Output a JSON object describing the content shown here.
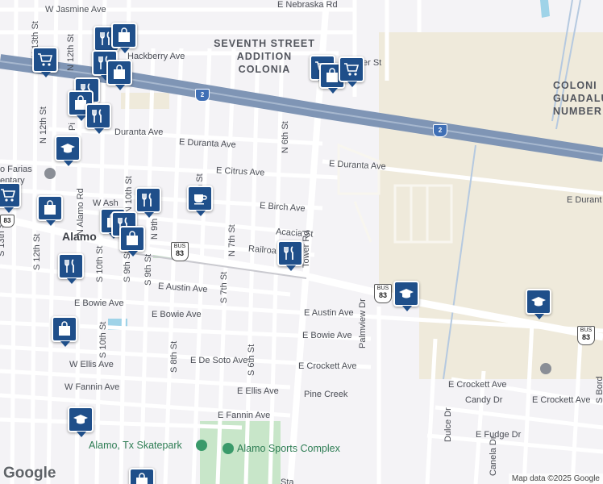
{
  "map": {
    "city": "Alamo",
    "neighborhoods": {
      "seventh_street": [
        "SEVENTH STREET",
        "ADDITION",
        "COLONIA"
      ],
      "guadalupe": [
        "COLONI",
        "GUADALU",
        "NUMBER"
      ]
    },
    "streets": {
      "w_jasmine": "W Jasmine Ave",
      "e_nebraska": "E Nebraska Rd",
      "hackberry": "Hackberry Ave",
      "er_st": "er St",
      "n_13th": "N 13th St",
      "n_12th_top": "N 12th St",
      "n_12th_left": "N 12th St",
      "pi": "Pi",
      "duranta_w": "Duranta Ave",
      "e_duranta_mid": "E Duranta Ave",
      "e_duranta_right": "E Duranta Ave",
      "e_durant_far": "E Durant",
      "n_6th": "N 6th St",
      "e_citrus": "E Citrus Ave",
      "th_st": "th St",
      "e_birch": "E Birch Ave",
      "w_ash": "W Ash",
      "n_alamo": "N Alamo Rd",
      "n_10th": "N 10th St",
      "n_9th": "N 9th",
      "n_7th": "N 7th St",
      "acacia": "Acacia St",
      "railroad": "Railroa",
      "tower": "Tower Rd",
      "s_13th": "S 13th St",
      "s_12th": "S 12th St",
      "s_10th_a": "S 10th St",
      "s_9th_a": "S 9th St",
      "s_9th_b": "S 9th St",
      "s_7th": "S 7th St",
      "e_austin_left": "E Austin Ave",
      "e_austin_right": "E Austin Ave",
      "e_bowie_w": "E Bowie Ave",
      "e_bowie_mid": "E Bowie Ave",
      "e_bowie_right": "E Bowie Ave",
      "s_10th_b": "S 10th St",
      "palmview": "Palmview Dr",
      "s_8th": "S 8th St",
      "e_de_soto": "E De Soto Ave",
      "s_6th": "S 6th St",
      "e_crockett_mid": "E Crockett Ave",
      "w_ellis": "W Ellis Ave",
      "w_fannin": "W Fannin Ave",
      "e_ellis": "E Ellis Ave",
      "pine_creek": "Pine Creek",
      "e_fannin": "E Fannin Ave",
      "e_crockett_right1": "E Crockett Ave",
      "e_crockett_right2": "E Crockett Ave",
      "candy": "Candy Dr",
      "e_fudge": "E Fudge Dr",
      "dulce": "Dulce Dr",
      "canela": "Canela Dr",
      "s_bord": "S Bord",
      "sta": "Sta"
    },
    "places": {
      "farias_school": [
        "o Farias",
        "entary"
      ],
      "skatepark": "Alamo, Tx Skatepark",
      "sports_complex": "Alamo Sports Complex"
    },
    "shields": {
      "i2_a": "2",
      "i2_b": "2",
      "bus83_a": "83",
      "bus83_b": "83",
      "bus83_c": "83",
      "us83_left": "83",
      "us83_right": "83",
      "bus_word": "BUS"
    },
    "pins": [
      {
        "icon": "restaurant"
      },
      {
        "icon": "shopping-bag"
      },
      {
        "icon": "shopping-cart"
      },
      {
        "icon": "restaurant"
      },
      {
        "icon": "shopping-bag"
      },
      {
        "icon": "restaurant"
      },
      {
        "icon": "shopping-bag"
      },
      {
        "icon": "restaurant"
      },
      {
        "icon": "school"
      },
      {
        "icon": "shopping-cart"
      },
      {
        "icon": "shopping-bag"
      },
      {
        "icon": "restaurant"
      },
      {
        "icon": "shopping-bag"
      },
      {
        "icon": "cafe"
      },
      {
        "icon": "restaurant"
      },
      {
        "icon": "shopping-cart"
      },
      {
        "icon": "shopping-bag"
      },
      {
        "icon": "shopping-cart"
      },
      {
        "icon": "restaurant"
      },
      {
        "icon": "school"
      },
      {
        "icon": "school"
      },
      {
        "icon": "shopping-bag"
      },
      {
        "icon": "school"
      },
      {
        "icon": "shopping-bag"
      }
    ],
    "google_logo": "Google",
    "attribution": "Map data ©2025 Google",
    "colors": {
      "pin": "#1f4f8a",
      "highway": "#8a9fbb",
      "road": "#ffffff",
      "land": "#f4f3f6",
      "tan": "#efeadb",
      "park": "#c8e6c9"
    }
  }
}
